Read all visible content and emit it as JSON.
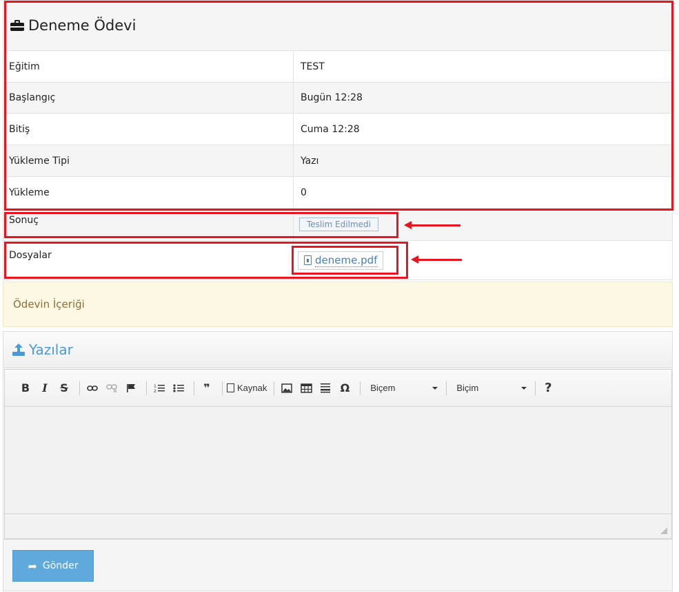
{
  "assignment": {
    "title": "Deneme Ödevi",
    "icon": "briefcase-icon"
  },
  "details": [
    {
      "label": "Eğitim",
      "value": "TEST"
    },
    {
      "label": "Başlangıç",
      "value": "Bugün 12:28"
    },
    {
      "label": "Bitiş",
      "value": "Cuma 12:28"
    },
    {
      "label": "Yükleme Tipi",
      "value": "Yazı"
    },
    {
      "label": "Yükleme",
      "value": "0"
    }
  ],
  "result": {
    "label": "Sonuç",
    "badge": "Teslim Edilmedi"
  },
  "files": {
    "label": "Dosyalar",
    "items": [
      "deneme.pdf"
    ]
  },
  "content_panel": {
    "label": "Ödevin İçeriği"
  },
  "editor": {
    "panel_title": "Yazılar",
    "toolbar": {
      "bold": "B",
      "italic": "I",
      "strike": "S",
      "blockquote": "❞",
      "source": "Kaynak",
      "special_char": "Ω",
      "style_combo": "Biçem",
      "format_combo": "Biçim",
      "help": "?"
    }
  },
  "actions": {
    "send_label": "Gönder"
  },
  "colors": {
    "annotation": "#e8141e",
    "accent": "#4c9ad4",
    "warning_bg": "#fcf8e3"
  }
}
